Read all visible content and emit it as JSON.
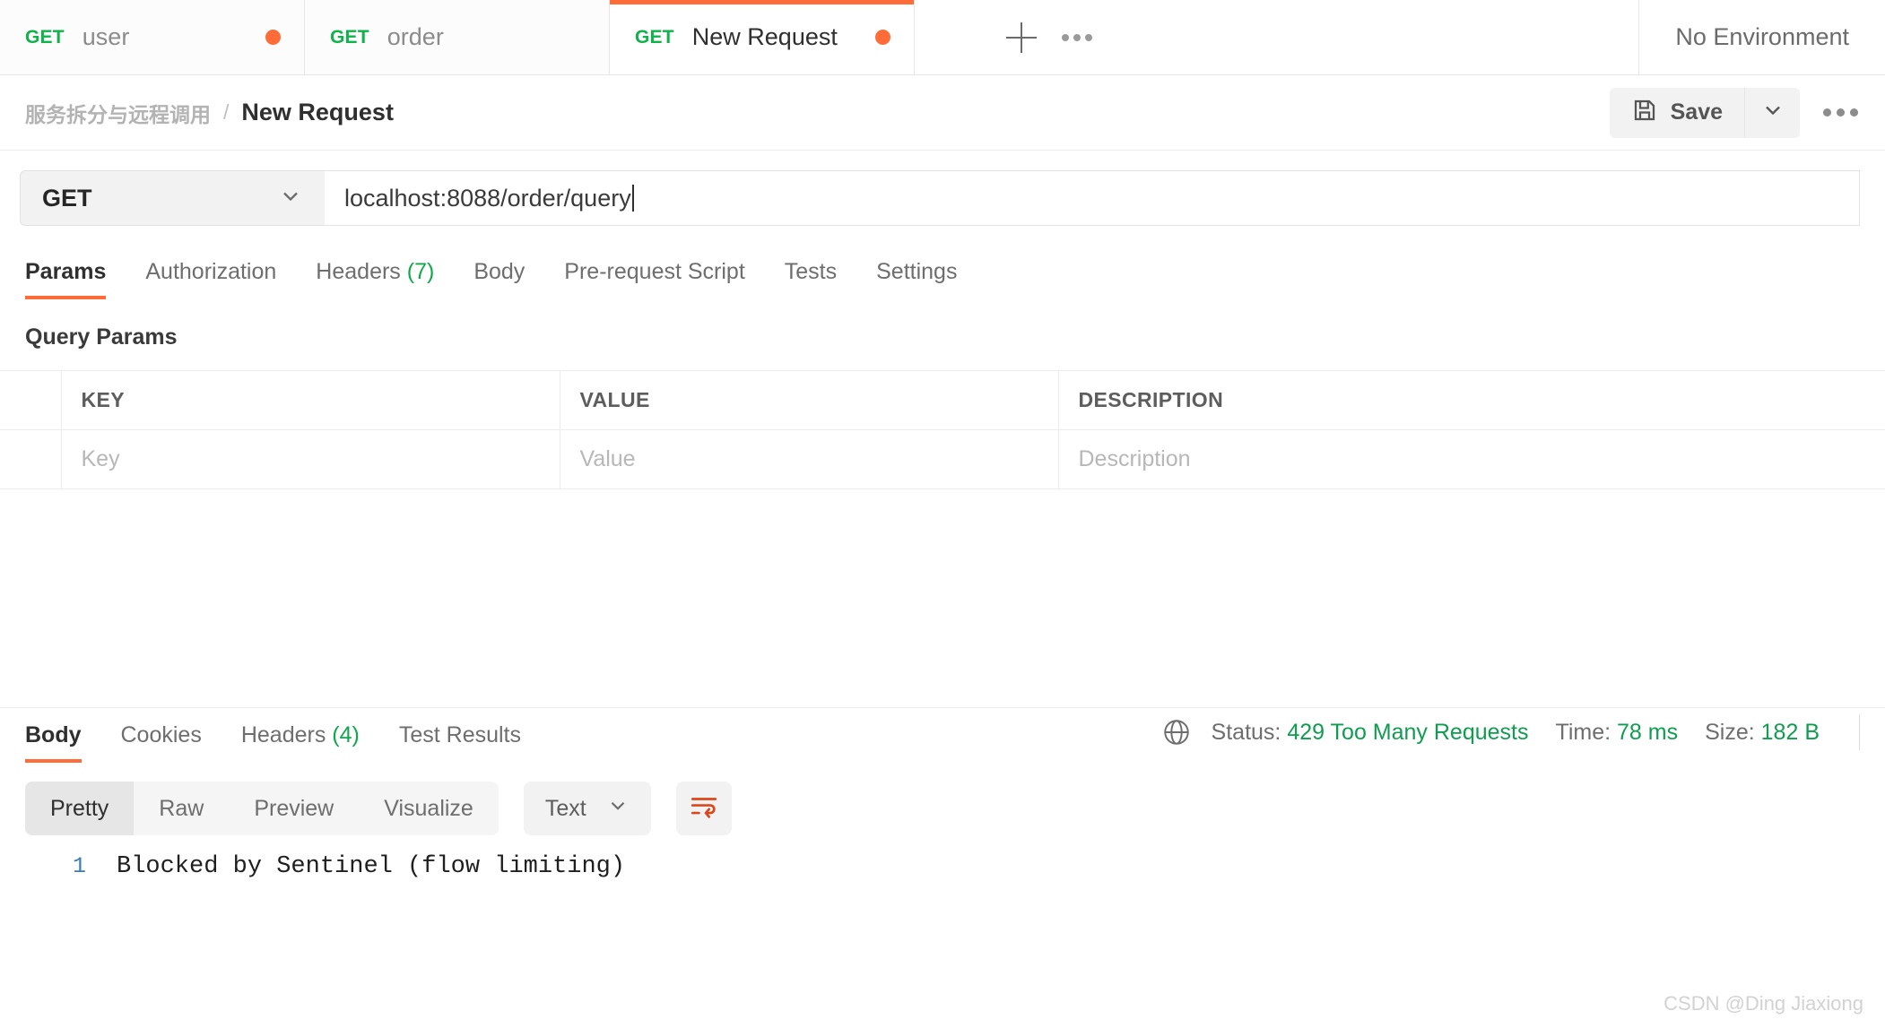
{
  "tabbar": {
    "tabs": [
      {
        "method": "GET",
        "title": "user",
        "unsaved": true,
        "active": false
      },
      {
        "method": "GET",
        "title": "order",
        "unsaved": false,
        "active": false
      },
      {
        "method": "GET",
        "title": "New Request",
        "unsaved": true,
        "active": true
      }
    ],
    "new_tab_label": "+",
    "more_label": "000",
    "environment": "No Environment"
  },
  "breadcrumb": {
    "collection": "服务拆分与远程调用",
    "separator": "/",
    "current": "New Request"
  },
  "toolbar": {
    "save_label": "Save"
  },
  "request": {
    "method": "GET",
    "url": "localhost:8088/order/query",
    "tabs": [
      {
        "label": "Params",
        "count": "",
        "active": true
      },
      {
        "label": "Authorization",
        "count": "",
        "active": false
      },
      {
        "label": "Headers",
        "count": "(7)",
        "active": false
      },
      {
        "label": "Body",
        "count": "",
        "active": false
      },
      {
        "label": "Pre-request Script",
        "count": "",
        "active": false
      },
      {
        "label": "Tests",
        "count": "",
        "active": false
      },
      {
        "label": "Settings",
        "count": "",
        "active": false
      }
    ],
    "params_title": "Query Params",
    "params_headers": [
      "KEY",
      "VALUE",
      "DESCRIPTION"
    ],
    "params_rows": [
      {
        "key": "Key",
        "value": "Value",
        "description": "Description"
      }
    ]
  },
  "response": {
    "tabs": [
      {
        "label": "Body",
        "count": "",
        "active": true
      },
      {
        "label": "Cookies",
        "count": "",
        "active": false
      },
      {
        "label": "Headers",
        "count": "(4)",
        "active": false
      },
      {
        "label": "Test Results",
        "count": "",
        "active": false
      }
    ],
    "status_label": "Status:",
    "status_value": "429 Too Many Requests",
    "time_label": "Time:",
    "time_value": "78 ms",
    "size_label": "Size:",
    "size_value": "182 B",
    "view_modes": [
      {
        "label": "Pretty",
        "active": true
      },
      {
        "label": "Raw",
        "active": false
      },
      {
        "label": "Preview",
        "active": false
      },
      {
        "label": "Visualize",
        "active": false
      }
    ],
    "format": "Text",
    "body_line_number": "1",
    "body_text": "Blocked by Sentinel (flow limiting)"
  },
  "colors": {
    "accent": "#ff6c37",
    "method_green": "#10b24b",
    "status_green": "#0f9d4f",
    "line_number_blue": "#3a7fb0"
  },
  "watermark": "CSDN @Ding Jiaxiong"
}
